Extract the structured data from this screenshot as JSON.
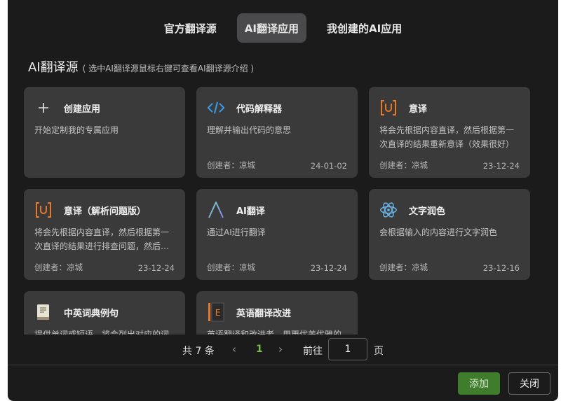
{
  "tabs": [
    {
      "label": "官方翻译源",
      "active": false
    },
    {
      "label": "AI翻译应用",
      "active": true
    },
    {
      "label": "我创建的AI应用",
      "active": false
    }
  ],
  "section": {
    "title": "AI翻译源",
    "hint": "( 选中AI翻译源鼠标右键可查看AI翻译源介绍 )"
  },
  "cards": [
    {
      "icon": "plus-icon",
      "title": "创建应用",
      "desc": "开始定制我的专属应用",
      "creator": "",
      "date": ""
    },
    {
      "icon": "code-icon",
      "title": "代码解释器",
      "desc": "理解并输出代码的意思",
      "creator": "创建者：凉城",
      "date": "24-01-02"
    },
    {
      "icon": "u-bracket-icon",
      "title": "意译",
      "desc": "将会先根据内容直译，然后根据第一次直译的结果重新意译（效果很好）",
      "creator": "创建者：凉城",
      "date": "23-12-24"
    },
    {
      "icon": "u-bracket-icon",
      "title": "意译（解析问题版）",
      "desc": "将会先根据内容直译，然后根据第一次直译的结果进行排查问题，然后再进行意译",
      "creator": "创建者：凉城",
      "date": "23-12-24"
    },
    {
      "icon": "lambda-icon",
      "title": "AI翻译",
      "desc": "通过AI进行翻译",
      "creator": "创建者：凉城",
      "date": "23-12-24"
    },
    {
      "icon": "atom-icon",
      "title": "文字润色",
      "desc": "会根据输入的内容进行文字润色",
      "creator": "创建者：凉城",
      "date": "23-12-16"
    },
    {
      "icon": "book-icon",
      "title": "中英词典例句",
      "desc": "提供单词或短语，将会列出对应的词典例句",
      "creator": "",
      "date": ""
    },
    {
      "icon": "e-book-icon",
      "title": "英语翻译改进",
      "desc": "英语翻译和改进者，用更优美优雅的词汇替换",
      "creator": "",
      "date": ""
    }
  ],
  "pager": {
    "total": "共 7 条",
    "prev": "‹",
    "current": "1",
    "next": "›",
    "goto": "前往",
    "jump_value": "1",
    "page_unit": "页"
  },
  "footer": {
    "add_label": "添加",
    "close_label": "关闭"
  },
  "colors": {
    "accent_green": "#7bbd4a",
    "add_button": "#3f7d2c",
    "code_icon": "#3b9ae8",
    "u_icon": "#e8792b",
    "atom_icon": "#6bb6e8"
  }
}
